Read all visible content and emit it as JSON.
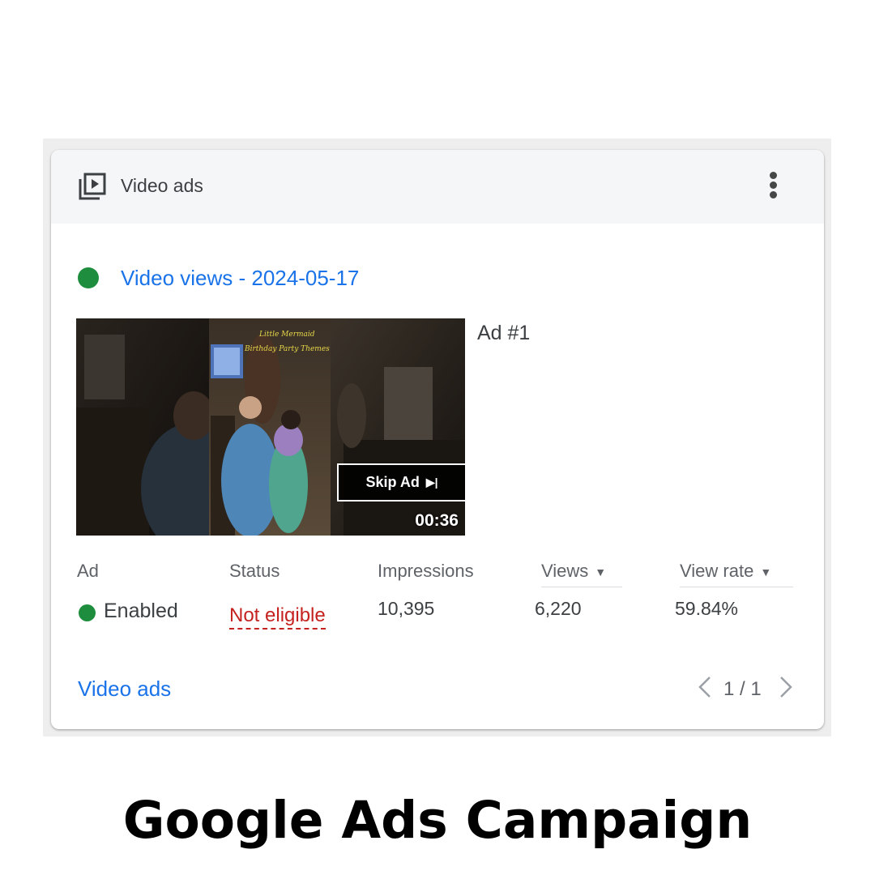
{
  "card": {
    "header_title": "Video ads",
    "header_icon": "video-library-icon",
    "menu_icon": "more-vert-icon"
  },
  "campaign": {
    "name": "Video views - 2024-05-17",
    "status_color": "#1e8e3e"
  },
  "video": {
    "overlay_text": "Skip Ad",
    "duration": "00:36"
  },
  "ad": {
    "name": "Ad #1"
  },
  "table": {
    "columns": [
      "Ad",
      "Status",
      "Impressions",
      "Views",
      "View rate"
    ],
    "row": {
      "ad": "Enabled",
      "status": "Not eligible",
      "impressions": "10,395",
      "views": "6,220",
      "view_rate": "59.84%"
    }
  },
  "footer": {
    "link": "Video ads",
    "pagination": "1 / 1"
  },
  "caption": "Google Ads Campaign",
  "colors": {
    "link": "#1a73e8",
    "enabled": "#1e8e3e",
    "error": "#c5221f"
  }
}
